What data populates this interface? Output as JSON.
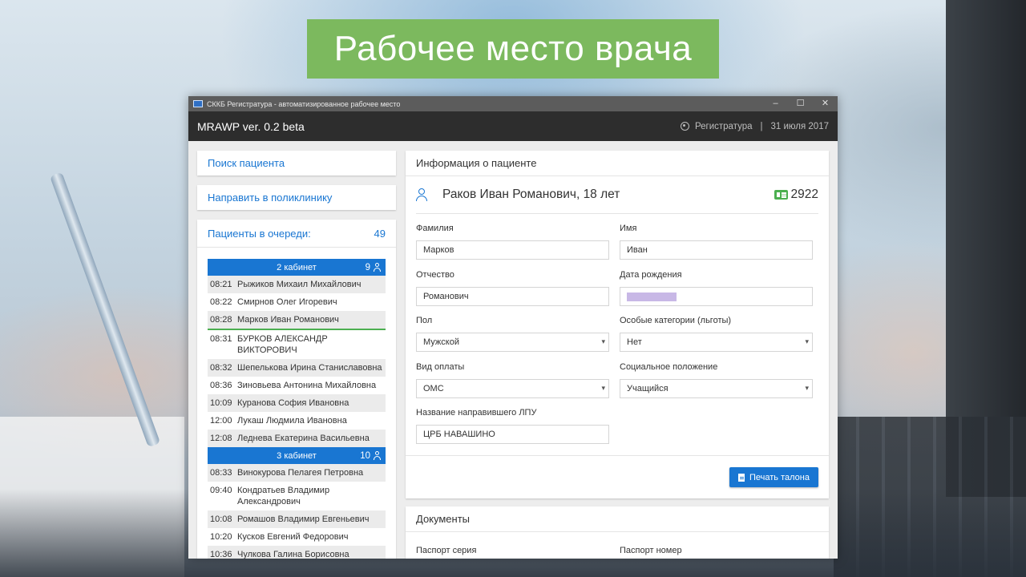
{
  "banner": {
    "title": "Рабочее место врача"
  },
  "window": {
    "title": "СККБ Регистратура - автоматизированное рабочее место",
    "controls": {
      "minimize": "–",
      "maximize": "☐",
      "close": "✕"
    }
  },
  "appbar": {
    "title": "MRAWP ver. 0.2 beta",
    "user": "Регистратура",
    "separator": "|",
    "date": "31 июля 2017"
  },
  "sidebar": {
    "search_label": "Поиск пациента",
    "refer_label": "Направить в поликлинику",
    "queue_title": "Пациенты в очереди:",
    "queue_count": "49",
    "cabinets": [
      {
        "name": "2 кабинет",
        "count": "9",
        "patients": [
          {
            "time": "08:21",
            "name": "Рыжиков Михаил Михайлович"
          },
          {
            "time": "08:22",
            "name": "Смирнов Олег Игоревич"
          },
          {
            "time": "08:28",
            "name": "Марков Иван Романович"
          },
          {
            "time": "08:31",
            "name": "БУРКОВ АЛЕКСАНДР ВИКТОРОВИЧ"
          },
          {
            "time": "08:32",
            "name": "Шепелькова Ирина Станиславовна"
          },
          {
            "time": "08:36",
            "name": "Зиновьева Антонина Михайловна"
          },
          {
            "time": "10:09",
            "name": "Куранова София Ивановна"
          },
          {
            "time": "12:00",
            "name": "Лукаш Людмила Ивановна"
          },
          {
            "time": "12:08",
            "name": "Леднева Екатерина Васильевна"
          }
        ]
      },
      {
        "name": "3 кабинет",
        "count": "10",
        "patients": [
          {
            "time": "08:33",
            "name": "Винокурова Пелагея Петровна"
          },
          {
            "time": "09:40",
            "name": "Кондратьев Владимир Александрович"
          },
          {
            "time": "10:08",
            "name": "Ромашов Владимир Евгеньевич"
          },
          {
            "time": "10:20",
            "name": "Кусков Евгений Федорович"
          },
          {
            "time": "10:36",
            "name": "Чулкова Галина Борисовна"
          }
        ]
      }
    ]
  },
  "patient_info": {
    "header": "Информация о пациенте",
    "name": "Раков Иван Романович, 18 лет",
    "card_number": "2922",
    "fields": {
      "surname": {
        "label": "Фамилия",
        "value": "Марков"
      },
      "firstname": {
        "label": "Имя",
        "value": "Иван"
      },
      "patronymic": {
        "label": "Отчество",
        "value": "Романович"
      },
      "birthdate": {
        "label": "Дата рождения",
        "value": ""
      },
      "sex": {
        "label": "Пол",
        "value": "Мужской"
      },
      "category": {
        "label": "Особые категории (льготы)",
        "value": "Нет"
      },
      "payment": {
        "label": "Вид оплаты",
        "value": "ОМС"
      },
      "social": {
        "label": "Социальное положение",
        "value": "Учащийся"
      },
      "referrer": {
        "label": "Название направившего ЛПУ",
        "value": "ЦРБ НАВАШИНО"
      }
    },
    "print_button": "Печать талона"
  },
  "documents": {
    "header": "Документы",
    "passport_series_label": "Паспорт серия",
    "passport_number_label": "Паспорт номер"
  },
  "colors": {
    "accent": "#1976d2",
    "banner": "#7cb95e",
    "appbar": "#2d2d2d",
    "selected_underline": "#4caf50"
  },
  "icons": {
    "user": "user-circle-icon",
    "person": "person-icon",
    "card": "id-card-icon",
    "print": "document-icon"
  }
}
